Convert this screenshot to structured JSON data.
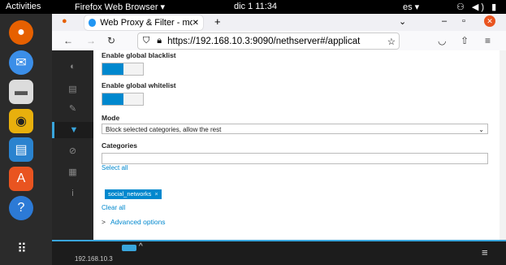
{
  "topbar": {
    "activities": "Activities",
    "app_name": "Firefox Web Browser ▾",
    "clock": "dic 1  11:34",
    "lang": "es ▾",
    "system_icons": "⚇ ◀) ▮ ▾"
  },
  "browser": {
    "tab_title": "Web Proxy & Filter - mon",
    "tab_close": "✕",
    "new_tab": "+",
    "url": "https://192.168.10.3:9090/nethserver#/applicat",
    "win_min": "–",
    "win_max": "▫",
    "win_close": "✕",
    "tabs_menu": "⌄"
  },
  "content": {
    "blacklist_label": "Enable global blacklist",
    "whitelist_label": "Enable global whitelist",
    "mode_label": "Mode",
    "mode_value": "Block selected categories, allow the rest",
    "categories_label": "Categories",
    "select_all": "Select all",
    "selected_chip": "social_networks",
    "chip_remove": "×",
    "clear_all": "Clear all",
    "advanced_options": "Advanced options",
    "blacklist_enabled": true,
    "whitelist_enabled": true
  },
  "bottom": {
    "host": "192.168.10.3"
  },
  "colors": {
    "accent": "#0088ce",
    "sidebar": "#262626",
    "dock": "#2b2b2b"
  }
}
